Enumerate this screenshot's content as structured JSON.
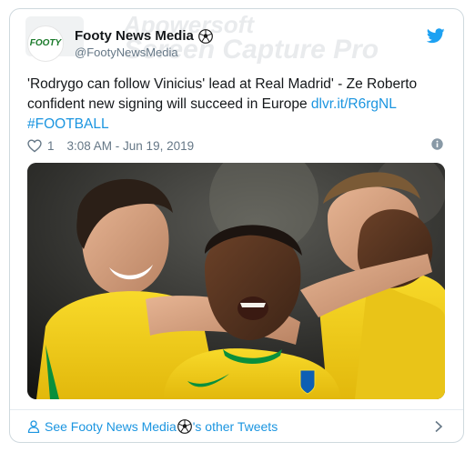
{
  "watermark": {
    "line1": "Apowersoft",
    "line2": "Screen Capture Pro"
  },
  "header": {
    "avatar_text": "FOOTY",
    "display_name": "Footy News Media",
    "handle": "@FootyNewsMedia",
    "verified_icon": "soccer-ball-emoji",
    "platform_icon": "twitter-bird-icon"
  },
  "tweet": {
    "text_main": "'Rodrygo can follow Vinicius' lead at Real Madrid' - Ze Roberto confident new signing will succeed in Europe ",
    "link": "dlvr.it/R6rgNL",
    "hashtag": "#FOOTBALL"
  },
  "meta": {
    "like_count": "1",
    "timestamp": "3:08 AM - Jun 19, 2019"
  },
  "footer": {
    "see_prefix": "See Footy News Media ",
    "see_suffix": "'s other Tweets"
  },
  "colors": {
    "link": "#1b95e0",
    "text": "#14171a",
    "muted": "#657786",
    "border": "#cfd9de",
    "brazil_yellow": "#f7d317",
    "brazil_green": "#0a8f3c"
  }
}
